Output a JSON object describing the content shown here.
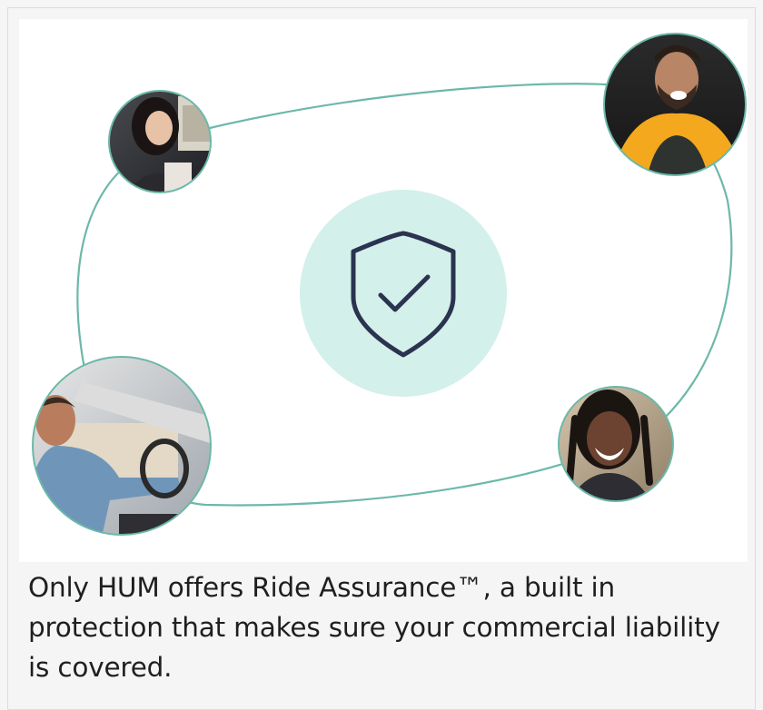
{
  "caption": {
    "text": "Only HUM offers Ride Assurance™, a built in protection that makes sure your commercial liability is covered."
  },
  "illustration": {
    "center_icon": "shield-check-icon",
    "colors": {
      "ring_stroke": "#6cb8a8",
      "center_circle": "#d3f0ea",
      "shield_stroke": "#2b3350",
      "background": "#ffffff",
      "card_background": "#f5f5f5"
    },
    "photos": [
      {
        "name": "woman-smiling-in-car-photo"
      },
      {
        "name": "man-in-yellow-hoodie-photo"
      },
      {
        "name": "man-driving-car-photo"
      },
      {
        "name": "woman-with-braids-smiling-photo"
      }
    ]
  }
}
